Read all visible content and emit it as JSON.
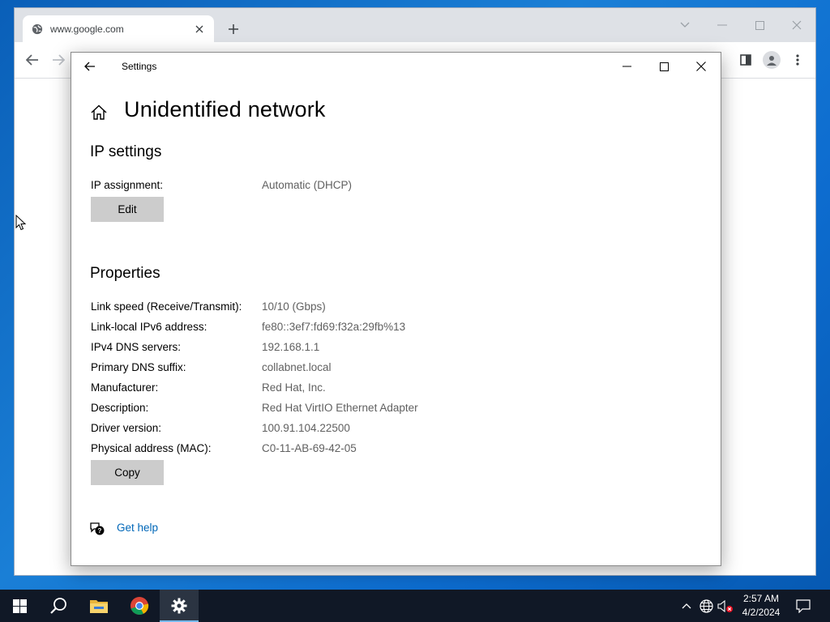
{
  "browser": {
    "tab_title": "www.google.com",
    "tab_icon": "globe-icon",
    "new_tab_icon": "plus-icon",
    "toolbar_icons": [
      "back-arrow-icon",
      "forward-arrow-icon",
      "side-panel-icon",
      "profile-icon",
      "more-menu-icon"
    ]
  },
  "settings": {
    "window_title": "Settings",
    "page_title": "Unidentified network",
    "ip_section": {
      "heading": "IP settings",
      "assignment_label": "IP assignment:",
      "assignment_value": "Automatic (DHCP)",
      "edit_label": "Edit"
    },
    "properties_section": {
      "heading": "Properties",
      "rows": [
        {
          "label": "Link speed (Receive/Transmit):",
          "value": "10/10 (Gbps)"
        },
        {
          "label": "Link-local IPv6 address:",
          "value": "fe80::3ef7:fd69:f32a:29fb%13"
        },
        {
          "label": "IPv4 DNS servers:",
          "value": "192.168.1.1"
        },
        {
          "label": "Primary DNS suffix:",
          "value": "collabnet.local"
        },
        {
          "label": "Manufacturer:",
          "value": "Red Hat, Inc."
        },
        {
          "label": "Description:",
          "value": "Red Hat VirtIO Ethernet Adapter"
        },
        {
          "label": "Driver version:",
          "value": "100.91.104.22500"
        },
        {
          "label": "Physical address (MAC):",
          "value": "C0-11-AB-69-42-05"
        }
      ],
      "copy_label": "Copy"
    },
    "help_label": "Get help"
  },
  "taskbar": {
    "apps": [
      "start-icon",
      "search-icon",
      "file-explorer-icon",
      "chrome-icon",
      "settings-gear-icon"
    ],
    "tray": [
      "chevron-up-icon",
      "network-globe-icon",
      "volume-muted-icon"
    ],
    "time": "2:57 AM",
    "date": "4/2/2024",
    "notification_icon": "notification-icon"
  },
  "colors": {
    "accent_link": "#0067b8",
    "button_bg": "#cccccc",
    "taskbar_bg": "#101826",
    "desktop_blue": "#0d6ccf"
  }
}
